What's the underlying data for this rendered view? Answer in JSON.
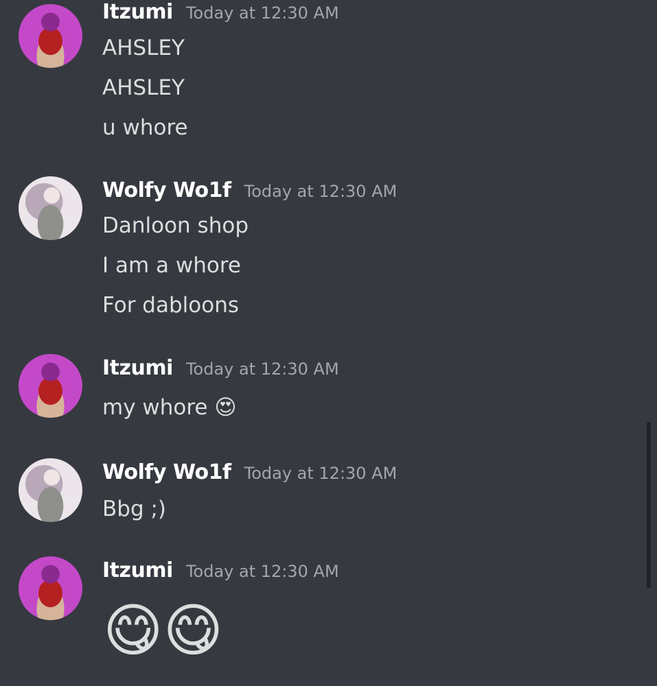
{
  "messages": [
    {
      "author": "Itzumi",
      "timestamp": "Today at 12:30 AM",
      "lines": [
        "AHSLEY",
        "AHSLEY",
        "u whore"
      ]
    },
    {
      "author": "Wolfy Wo1f",
      "timestamp": "Today at 12:30 AM",
      "lines": [
        "Danloon shop",
        "I am a whore",
        "For dabloons"
      ]
    },
    {
      "author": "Itzumi",
      "timestamp": "Today at 12:30 AM",
      "lines": [
        "my whore"
      ],
      "emoji": "😍"
    },
    {
      "author": "Wolfy Wo1f",
      "timestamp": "Today at 12:30 AM",
      "lines": [
        "Bbg ;)"
      ]
    },
    {
      "author": "Itzumi",
      "timestamp": "Today at 12:30 AM",
      "emojis": [
        "😋",
        "😋"
      ]
    }
  ]
}
